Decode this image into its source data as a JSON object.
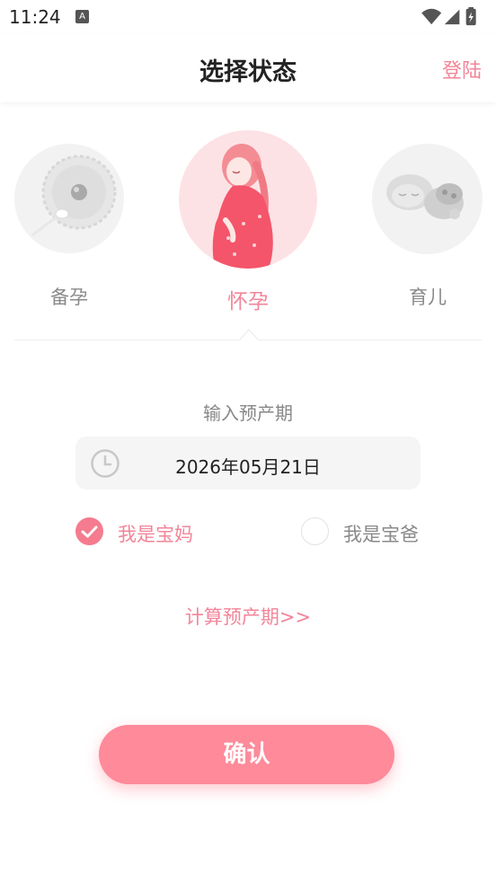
{
  "status_bar": {
    "time": "11:24",
    "notification_glyph": "A",
    "icons": [
      "wifi-icon",
      "signal-icon",
      "battery-charging-icon"
    ]
  },
  "header": {
    "title": "选择状态",
    "login_label": "登陆"
  },
  "stages": [
    {
      "label": "备孕",
      "selected": false,
      "icon": "sperm-egg-illustration"
    },
    {
      "label": "怀孕",
      "selected": true,
      "icon": "pregnant-woman-illustration"
    },
    {
      "label": "育儿",
      "selected": false,
      "icon": "sleeping-baby-illustration"
    }
  ],
  "due_date": {
    "label": "输入预产期",
    "value": "2026年05月21日",
    "icon": "clock-icon"
  },
  "roles": [
    {
      "label": "我是宝妈",
      "checked": true
    },
    {
      "label": "我是宝爸",
      "checked": false
    }
  ],
  "calc_link": "计算预产期>>",
  "confirm_label": "确认",
  "colors": {
    "accent": "#fe8a9a",
    "accent_text": "#f28599",
    "inactive_text": "#8a8a8a",
    "inactive_circle": "#f2f2f2"
  }
}
